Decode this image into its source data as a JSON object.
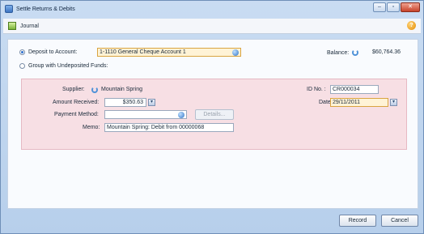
{
  "window": {
    "title": "Settle Returns & Debits",
    "buttons": {
      "minimize": "–",
      "maximize": "▫",
      "close": "✕"
    }
  },
  "toolbar": {
    "journal_label": "Journal",
    "help_symbol": "?"
  },
  "deposit": {
    "deposit_label": "Deposit to Account:",
    "account_value": "1-1110 General Cheque Account 1",
    "group_label": "Group with Undeposited Funds:",
    "balance_label": "Balance:",
    "balance_value": "$60,764.36"
  },
  "form": {
    "supplier_label": "Supplier:",
    "supplier_value": "Mountain Spring",
    "id_label": "ID No. :",
    "id_value": "CR000034",
    "amount_label": "Amount Received:",
    "amount_value": "$350.63",
    "date_label": "Date:",
    "date_value": "29/11/2011",
    "payment_label": "Payment Method:",
    "payment_value": "",
    "details_label": "Details...",
    "memo_label": "Memo:",
    "memo_value": "Mountain Spring: Debit from 00000068"
  },
  "footer": {
    "record_label": "Record",
    "cancel_label": "Cancel"
  }
}
